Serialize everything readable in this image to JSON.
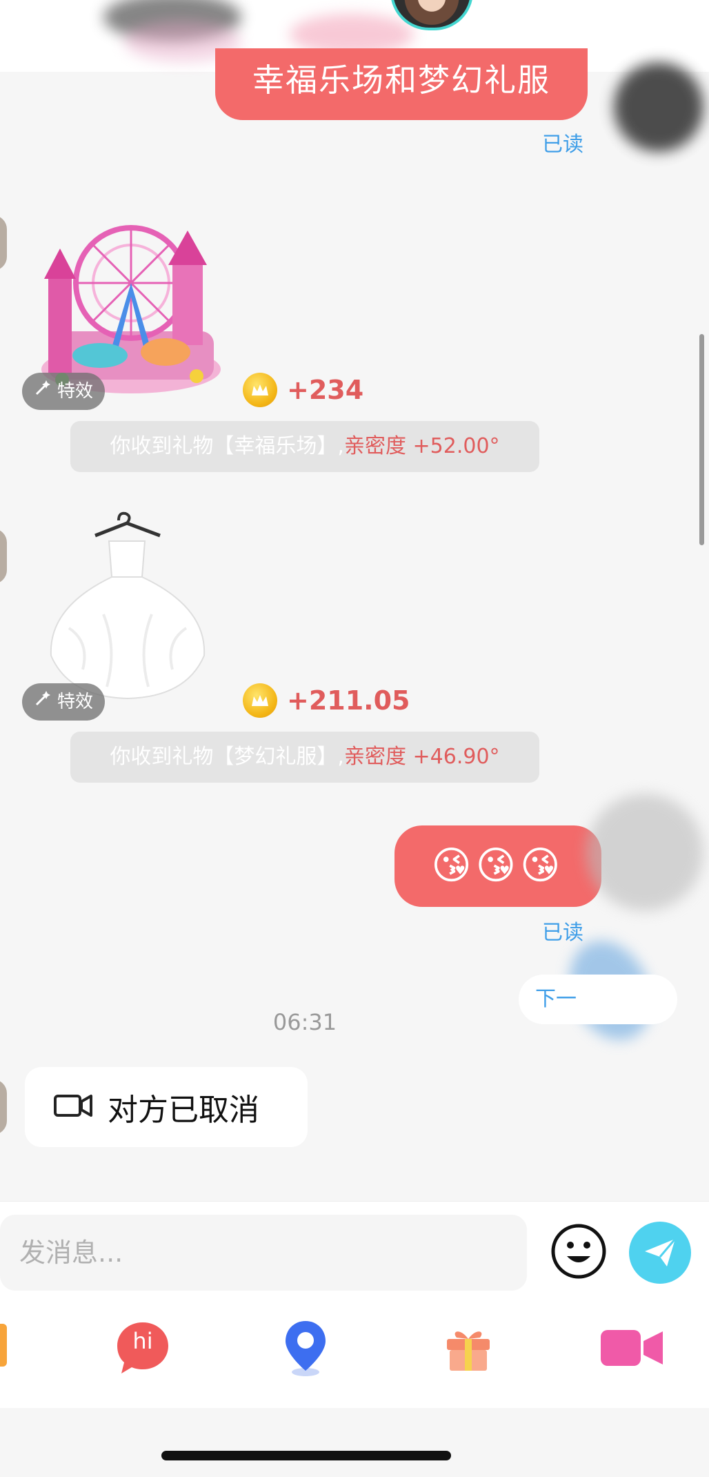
{
  "messages": {
    "top_bubble_text": "幸福乐场和梦幻礼服",
    "read_label": "已读",
    "gifts": [
      {
        "effect_label": "特效",
        "coin_amount": "+234",
        "notice_prefix": "你收到礼物【幸福乐场】,",
        "notice_intimacy": "亲密度 +52.00°"
      },
      {
        "effect_label": "特效",
        "coin_amount": "+211.05",
        "notice_prefix": "你收到礼物【梦幻礼服】,",
        "notice_intimacy": "亲密度 +46.90°"
      }
    ],
    "emoji_bubble": "😘😘😘",
    "next_pill": "下一",
    "timestamp": "06:31",
    "video_call_status": "对方已取消"
  },
  "input": {
    "placeholder": "发消息..."
  },
  "toolbar": {
    "hi_label": "hi"
  },
  "colors": {
    "outgoing_bubble": "#f36a6a",
    "read_label": "#3f9ee8",
    "send_button": "#4fd2ef",
    "hi_button": "#f05a5a",
    "location": "#3d6ef0",
    "gift": "#f58a6a",
    "video": "#f05aa8"
  }
}
